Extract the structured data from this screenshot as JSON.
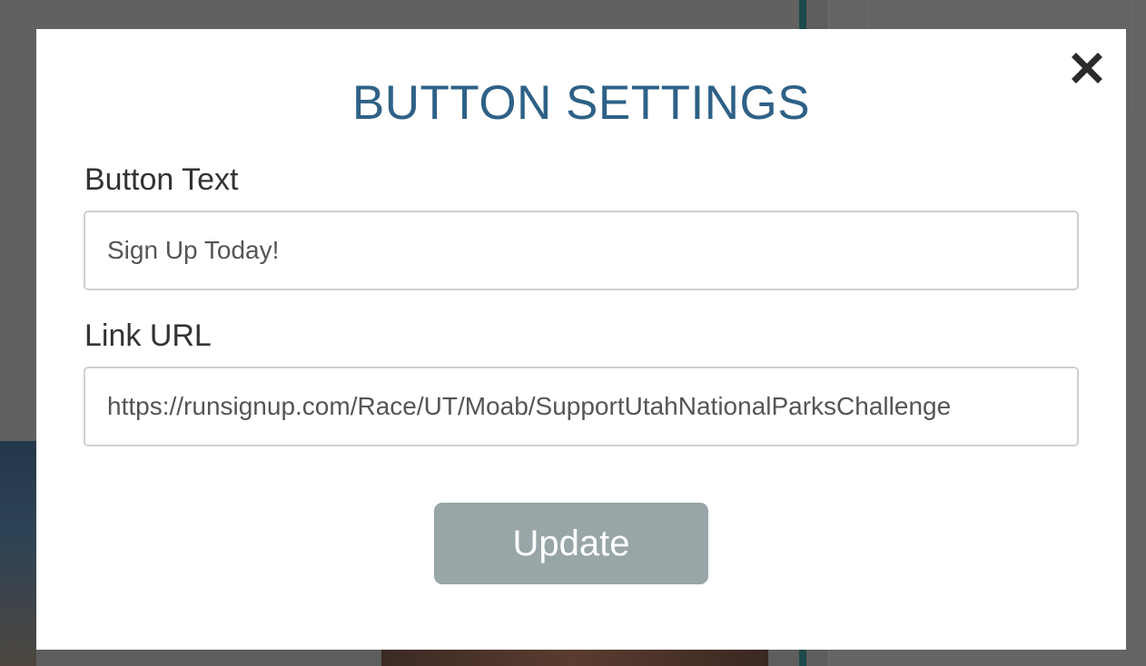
{
  "modal": {
    "title": "BUTTON SETTINGS",
    "close_icon": "close-icon"
  },
  "fields": {
    "button_text": {
      "label": "Button Text",
      "value": "Sign Up Today!"
    },
    "link_url": {
      "label": "Link URL",
      "value": "https://runsignup.com/Race/UT/Moab/SupportUtahNationalParksChallenge"
    }
  },
  "actions": {
    "update_label": "Update"
  },
  "colors": {
    "title": "#2e6186",
    "update_button": "#98a6a8",
    "overlay": "#5d5d5d"
  }
}
